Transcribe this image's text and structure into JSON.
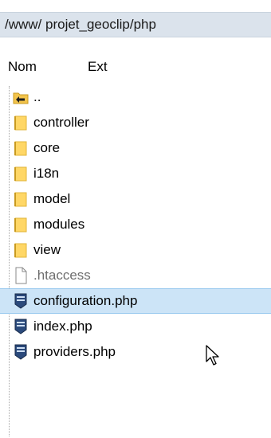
{
  "path_bar": {
    "path": "/www/ projet_geoclip/php"
  },
  "columns": {
    "name": "Nom",
    "ext": "Ext"
  },
  "files": [
    {
      "name": "..",
      "icon": "parent-folder-icon",
      "type": "parent",
      "selected": false
    },
    {
      "name": "controller",
      "icon": "folder-icon",
      "type": "folder",
      "selected": false
    },
    {
      "name": "core",
      "icon": "folder-icon",
      "type": "folder",
      "selected": false
    },
    {
      "name": "i18n",
      "icon": "folder-icon",
      "type": "folder",
      "selected": false
    },
    {
      "name": "model",
      "icon": "folder-icon",
      "type": "folder",
      "selected": false
    },
    {
      "name": "modules",
      "icon": "folder-icon",
      "type": "folder",
      "selected": false
    },
    {
      "name": "view",
      "icon": "folder-icon",
      "type": "folder",
      "selected": false
    },
    {
      "name": ".htaccess",
      "icon": "document-icon",
      "type": "file",
      "selected": false
    },
    {
      "name": "configuration.php",
      "icon": "php-file-icon",
      "type": "php",
      "selected": true
    },
    {
      "name": "index.php",
      "icon": "php-file-icon",
      "type": "php",
      "selected": false
    },
    {
      "name": "providers.php",
      "icon": "php-file-icon",
      "type": "php",
      "selected": false
    }
  ],
  "colors": {
    "path_bar_bg": "#dbe3ec",
    "selection_bg": "#cce4f7",
    "folder_yellow": "#ffd766",
    "php_icon_blue": "#2b4a7c"
  }
}
